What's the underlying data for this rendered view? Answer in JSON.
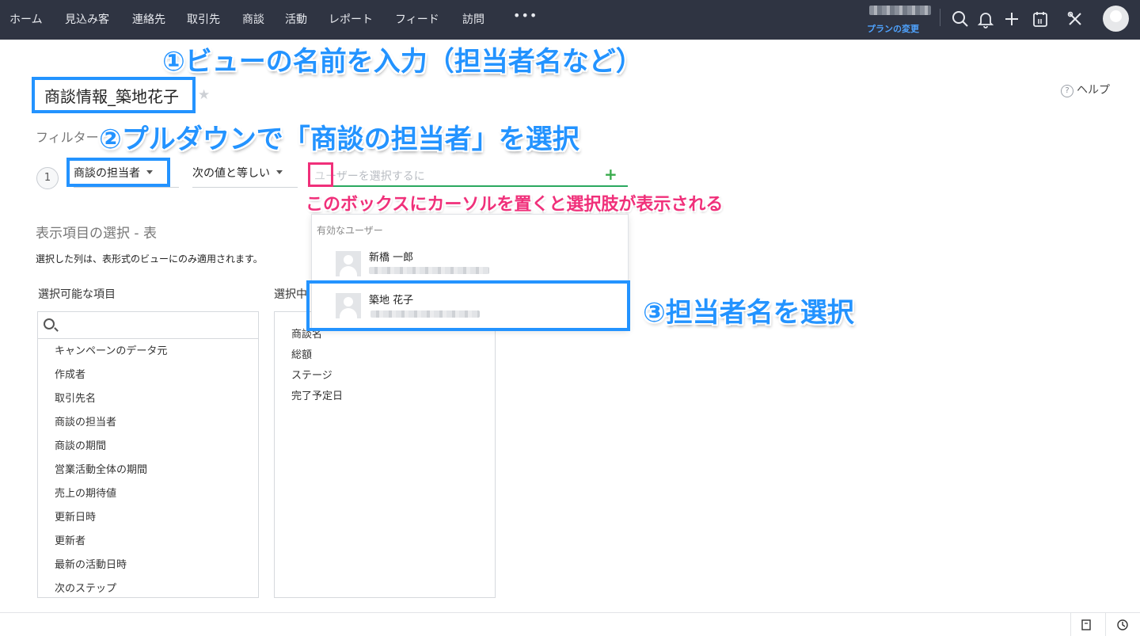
{
  "nav": {
    "items": [
      "ホーム",
      "見込み客",
      "連絡先",
      "取引先",
      "商談",
      "活動",
      "レポート",
      "フィード",
      "訪問"
    ],
    "more": "•••",
    "plan_link": "プランの変更"
  },
  "annotations": {
    "step1": "①ビューの名前を入力（担当者名など）",
    "step2": "②プルダウンで「商談の担当者」を選択",
    "step3": "③担当者名を選択",
    "cursor_hint": "このボックスにカーソルを置くと選択肢が表示される"
  },
  "view": {
    "name_value": "商談情報_築地花子",
    "help": "ヘルプ",
    "help_icon": "?"
  },
  "filter": {
    "label": "フィルター",
    "index": "1",
    "field": "商談の担当者",
    "operator": "次の値と等しい",
    "user_placeholder": "ユーザーを選択するに",
    "add_icon": "+"
  },
  "columns_section": {
    "title": "表示項目の選択 - 表",
    "note": "選択した列は、表形式のビューにのみ適用されます。",
    "available_title": "選択可能な項目",
    "selected_title": "選択中",
    "available_items": [
      "キャンペーンのデータ元",
      "作成者",
      "取引先名",
      "商談の担当者",
      "商談の期間",
      "営業活動全体の期間",
      "売上の期待値",
      "更新日時",
      "更新者",
      "最新の活動日時",
      "次のステップ"
    ],
    "selected_items": [
      "商談名",
      "総額",
      "ステージ",
      "完了予定日"
    ]
  },
  "dropdown": {
    "header": "有効なユーザー",
    "users": [
      {
        "name": "新橋 一郎"
      },
      {
        "name": "築地 花子"
      }
    ]
  },
  "colors": {
    "topbar": "#2f3442",
    "annotation_blue": "#2393ff",
    "annotation_pink": "#f0307a",
    "input_underline": "#2aa860"
  }
}
